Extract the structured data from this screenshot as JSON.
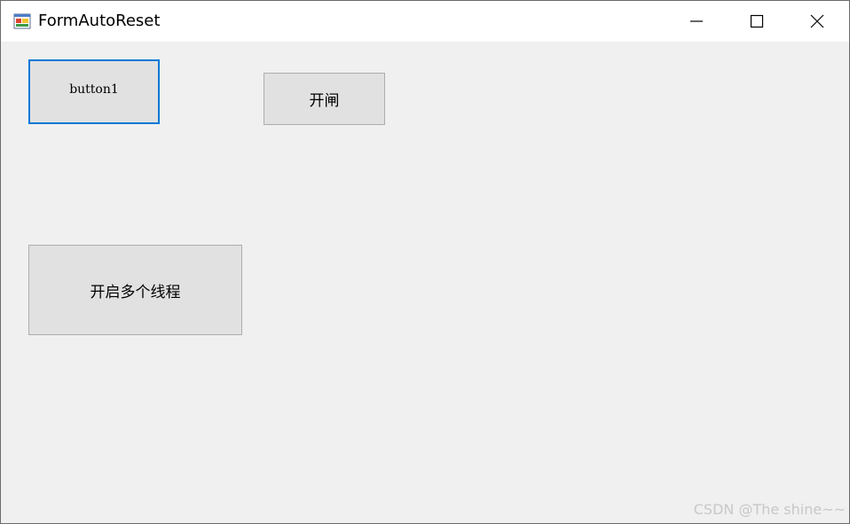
{
  "window": {
    "title": "FormAutoReset",
    "icon": "form-icon",
    "controls": {
      "minimize_icon": "minimize-icon",
      "maximize_icon": "maximize-icon",
      "close_icon": "close-icon"
    }
  },
  "buttons": {
    "button1_label": "button1",
    "open_gate_label": "开闸",
    "start_threads_label": "开启多个线程"
  },
  "watermark": "CSDN @The shine~~",
  "colors": {
    "focus_border": "#0078d7",
    "button_bg": "#e1e1e1",
    "client_bg": "#f0f0f0"
  }
}
